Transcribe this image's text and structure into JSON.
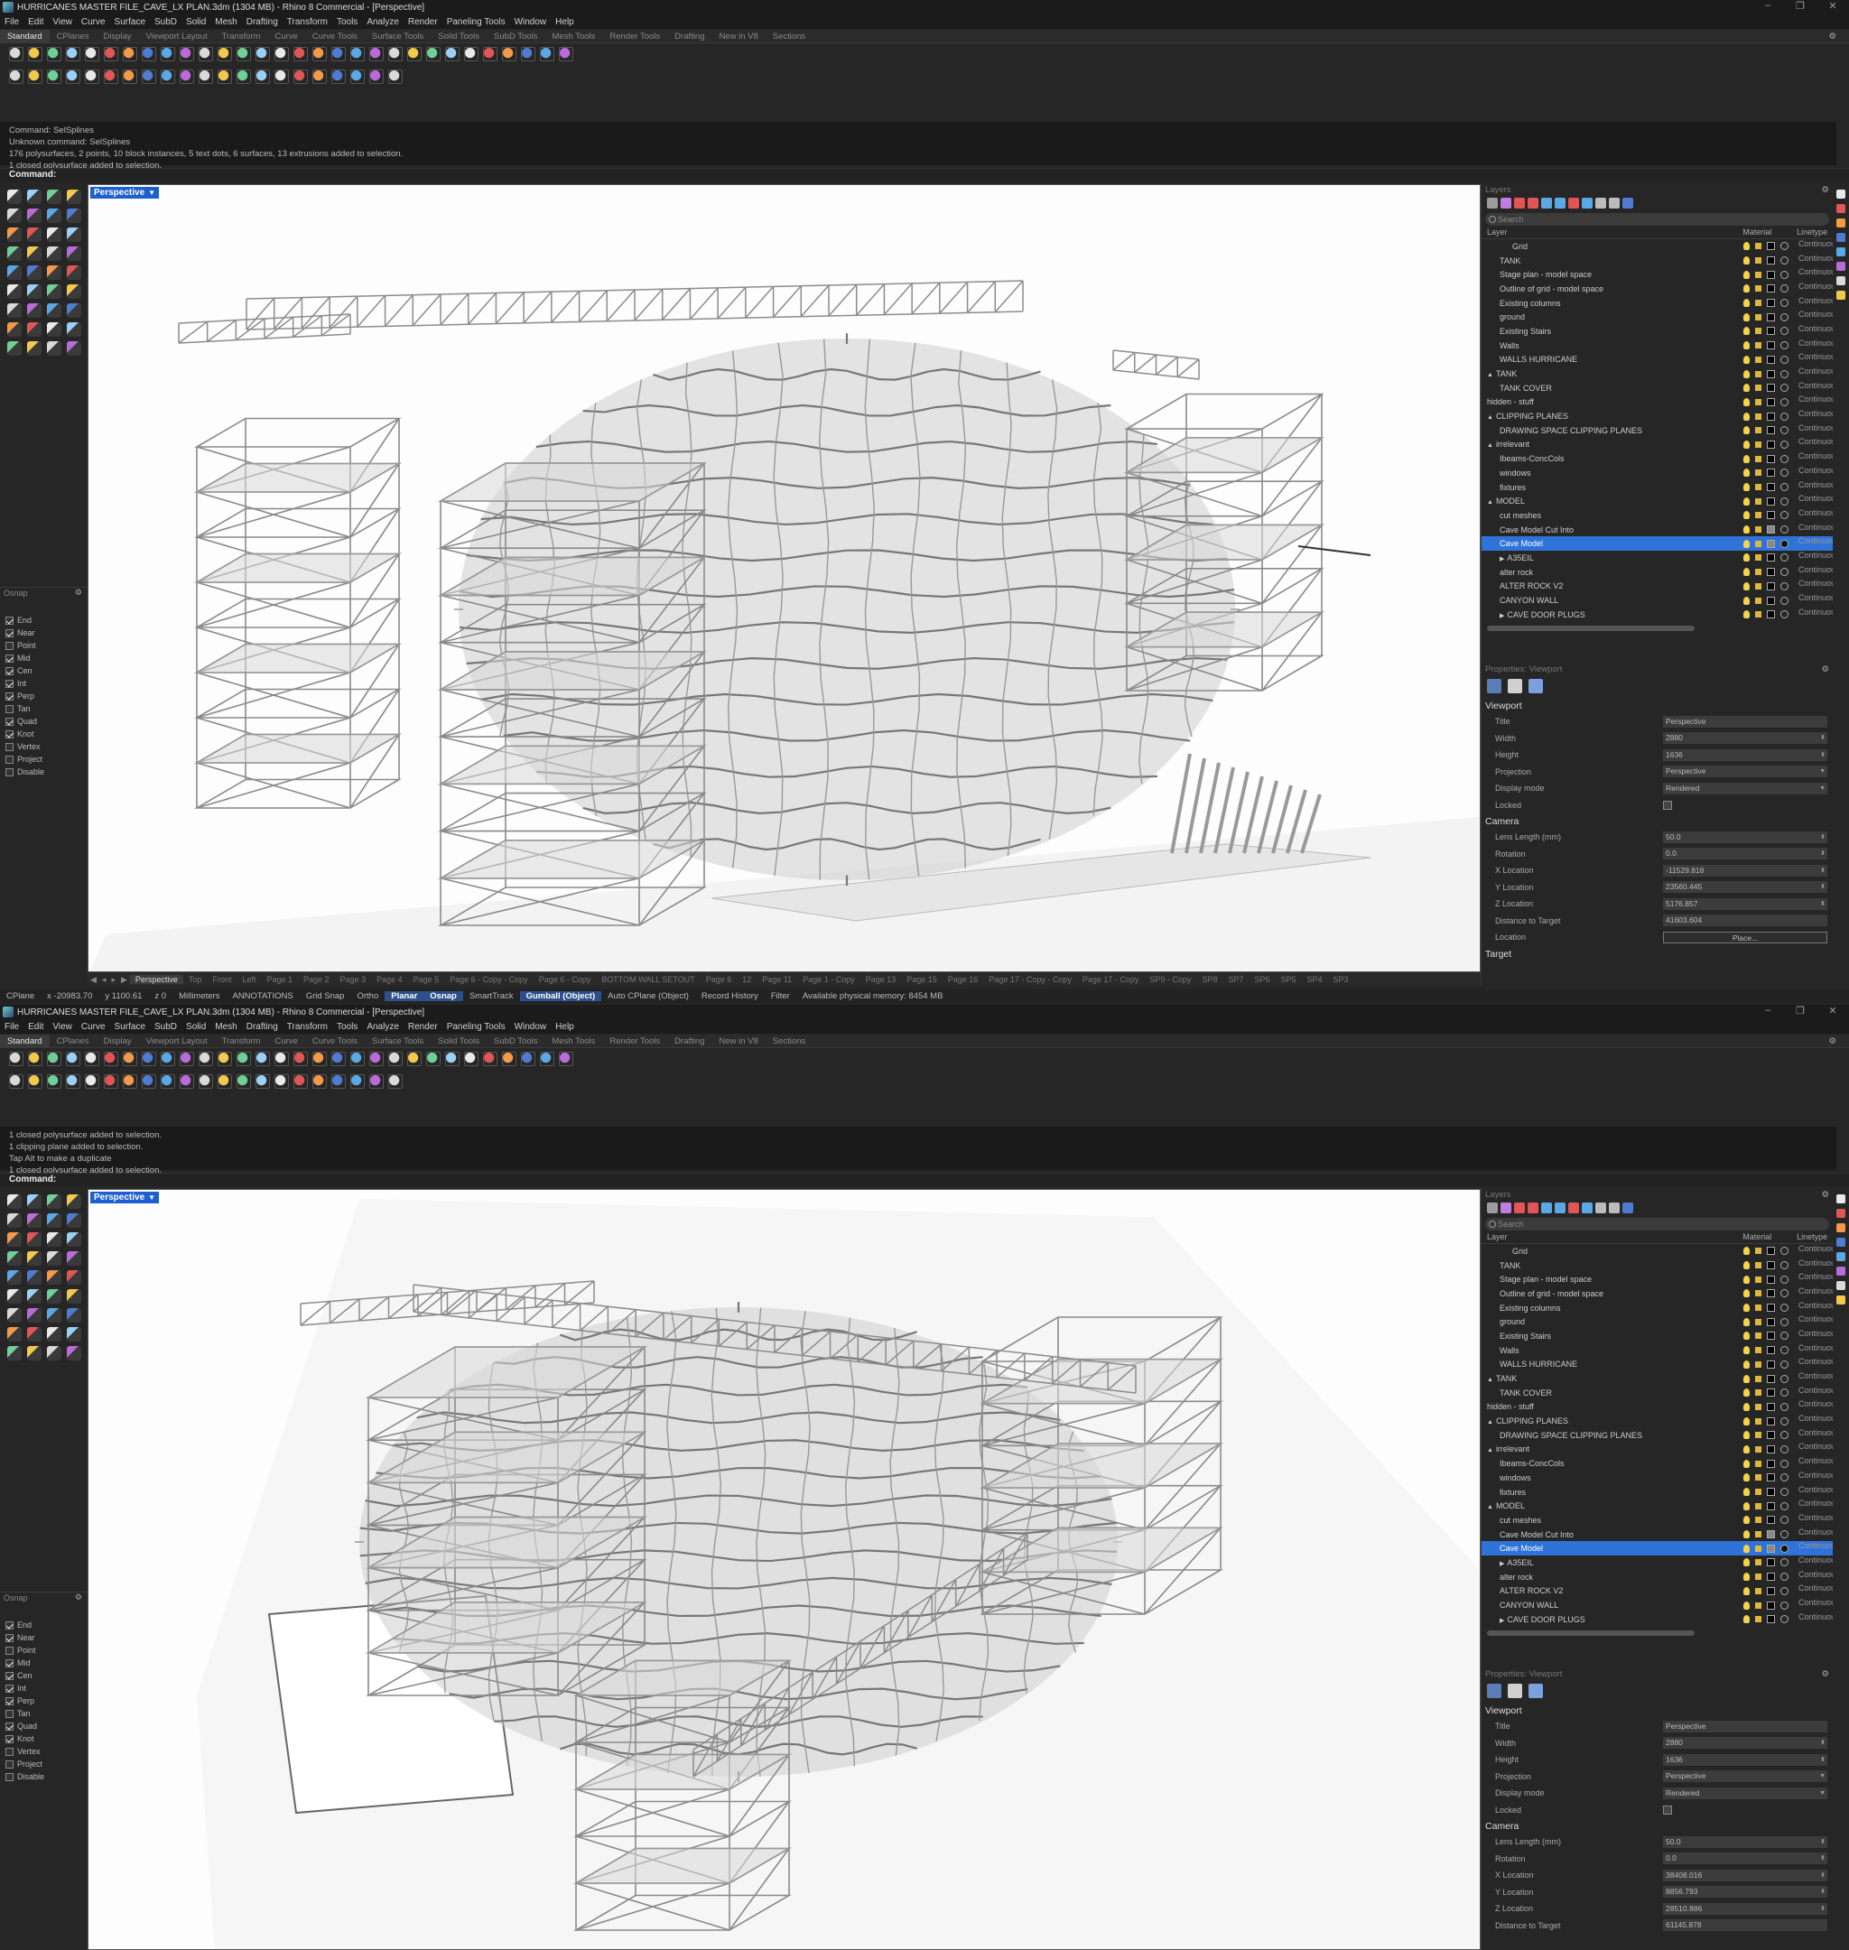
{
  "window": {
    "title": "HURRICANES MASTER FILE_CAVE_LX PLAN.3dm (1304 MB) - Rhino 8 Commercial - [Perspective]",
    "controls": [
      "–",
      "❐",
      "✕"
    ]
  },
  "menu": [
    "File",
    "Edit",
    "View",
    "Curve",
    "Surface",
    "SubD",
    "Solid",
    "Mesh",
    "Drafting",
    "Transform",
    "Tools",
    "Analyze",
    "Render",
    "Paneling Tools",
    "Window",
    "Help"
  ],
  "tabs": [
    "Standard",
    "CPlanes",
    "Display",
    "Viewport Layout",
    "Transform",
    "Curve",
    "Curve Tools",
    "Surface Tools",
    "Solid Tools",
    "SubD Tools",
    "Mesh Tools",
    "Render Tools",
    "Drafting",
    "New in V8",
    "Sections"
  ],
  "icons": {
    "toolbar1": [
      "new",
      "open",
      "save",
      "print",
      "import",
      "cut",
      "copy",
      "paste",
      "undo",
      "pan",
      "rotate",
      "zoom-extents",
      "zoom-window",
      "zoom-selected",
      "zoom-all",
      "viewport-layout",
      "4-views",
      "set-view",
      "display-shaded",
      "rendered",
      "properties",
      "layers",
      "lights",
      "sun",
      "bulb",
      "material",
      "environment",
      "render",
      "named-views",
      "help"
    ],
    "toolbar2": [
      "bulb-on",
      "bulb-all",
      "bulb-sel",
      "bulb-inv",
      "bulb-swap",
      "paper",
      "doc-props",
      "doc-stack",
      "lock",
      "unlock",
      "lock-sel",
      "hide",
      "show-sel",
      "grid",
      "grid-all",
      "render-win",
      "tool-lock",
      "tool-mesh",
      "cloud",
      "world",
      "sphere"
    ],
    "left": [
      "select",
      "point",
      "line",
      "polyline",
      "circle",
      "arc",
      "ellipse",
      "rectangle",
      "curve",
      "curve-cp",
      "fillet",
      "offset",
      "surface",
      "extrude",
      "loft",
      "sweep",
      "solid-box",
      "solid-sphere",
      "boolean",
      "shell",
      "move",
      "copy",
      "rotate",
      "scale",
      "text",
      "dim",
      "hatch",
      "annotate",
      "mesh",
      "grid-array",
      "mirror",
      "trim",
      "check",
      "split",
      "join",
      "sun"
    ]
  },
  "command_label": "Command:",
  "windows": [
    {
      "history": [
        "Command: SelSplines",
        "Unknown command: SelSplines",
        "176 polysurfaces, 2 points, 10 block instances, 5 text dots, 6 surfaces, 13 extrusions added to selection.",
        "1 closed polysurface added to selection."
      ],
      "viewport": {
        "name": "Perspective"
      },
      "pagetabs": [
        "Perspective",
        "Top",
        "Front",
        "Left",
        "Page 1",
        "Page 2",
        "Page 3",
        "Page 4",
        "Page 5",
        "Page 6 - Copy - Copy",
        "Page 6 - Copy",
        "BOTTOM WALL SETOUT",
        "Page 6",
        "12",
        "Page 11",
        "Page 1 - Copy",
        "Page 13",
        "Page 15",
        "Page 16",
        "Page 17 - Copy - Copy",
        "Page 17 - Copy",
        "SP9 - Copy",
        "SP8",
        "SP7",
        "SP6",
        "SP5",
        "SP4",
        "SP3"
      ],
      "status": {
        "cplane": "CPlane",
        "x": "x -20983.70",
        "y": "y 1100.61",
        "z": "z 0",
        "units": "Millimeters",
        "layer": "ANNOTATIONS",
        "grid_snap": "Grid Snap",
        "ortho": "Ortho",
        "planar": "Planar",
        "osnap": "Osnap",
        "smarttrack": "SmartTrack",
        "gumball": "Gumball (Object)",
        "auto_cplane": "Auto CPlane (Object)",
        "record_history": "Record History",
        "filter": "Filter",
        "memory": "Available physical memory: 8454 MB"
      },
      "camera": {
        "lens": "50.0",
        "rotation": "0.0",
        "x": "-11529.818",
        "y": "23560.445",
        "z": "5176.857",
        "distance": "41603.604"
      }
    },
    {
      "history": [
        "1 closed polysurface added to selection.",
        "1 clipping plane added to selection.",
        "Tap Alt to make a duplicate",
        "1 closed polysurface added to selection."
      ],
      "viewport": {
        "name": "Perspective"
      },
      "camera": {
        "lens": "50.0",
        "rotation": "0.0",
        "x": "38408.016",
        "y": "8856.793",
        "z": "28510.886",
        "distance": "61145.878"
      }
    }
  ],
  "osnap": {
    "title": "Osnap",
    "items": [
      {
        "label": "End",
        "on": true
      },
      {
        "label": "Near",
        "on": true
      },
      {
        "label": "Point",
        "on": false
      },
      {
        "label": "Mid",
        "on": true
      },
      {
        "label": "Cen",
        "on": true
      },
      {
        "label": "Int",
        "on": true
      },
      {
        "label": "Perp",
        "on": true
      },
      {
        "label": "Tan",
        "on": false
      },
      {
        "label": "Quad",
        "on": true
      },
      {
        "label": "Knot",
        "on": true
      },
      {
        "label": "Vertex",
        "on": false
      },
      {
        "label": "Project",
        "on": false
      },
      {
        "label": "Disable",
        "on": false
      }
    ]
  },
  "layers": {
    "title": "Layers",
    "search_placeholder": "Search",
    "headers": {
      "layer": "Layer",
      "material": "Material",
      "linetype": "Linetype"
    },
    "linetype_value": "Continuous",
    "rows": [
      {
        "name": "Grid",
        "indent": 2,
        "expand": "",
        "selected": false
      },
      {
        "name": "TANK",
        "indent": 1,
        "expand": "",
        "selected": false
      },
      {
        "name": "Stage plan - model space",
        "indent": 1,
        "expand": "",
        "selected": false
      },
      {
        "name": "Outline of grid - model space",
        "indent": 1,
        "expand": "",
        "selected": false
      },
      {
        "name": "Existing columns",
        "indent": 1,
        "expand": "",
        "selected": false
      },
      {
        "name": "ground",
        "indent": 1,
        "expand": "",
        "selected": false
      },
      {
        "name": "Existing Stairs",
        "indent": 1,
        "expand": "",
        "selected": false
      },
      {
        "name": "Walls",
        "indent": 1,
        "expand": "",
        "selected": false
      },
      {
        "name": "WALLS HURRICANE",
        "indent": 1,
        "expand": "",
        "selected": false
      },
      {
        "name": "TANK",
        "indent": 0,
        "expand": "▲",
        "selected": false
      },
      {
        "name": "TANK COVER",
        "indent": 1,
        "expand": "",
        "selected": false
      },
      {
        "name": "hidden - stuff",
        "indent": 0,
        "expand": "",
        "selected": false
      },
      {
        "name": "CLIPPING PLANES",
        "indent": 0,
        "expand": "▲",
        "selected": false
      },
      {
        "name": "DRAWING SPACE CLIPPING PLANES",
        "indent": 1,
        "expand": "",
        "selected": false
      },
      {
        "name": "irrelevant",
        "indent": 0,
        "expand": "▲",
        "selected": false
      },
      {
        "name": "Ibeams-ConcCols",
        "indent": 1,
        "expand": "",
        "selected": false
      },
      {
        "name": "windows",
        "indent": 1,
        "expand": "",
        "selected": false
      },
      {
        "name": "fixtures",
        "indent": 1,
        "expand": "",
        "selected": false
      },
      {
        "name": "MODEL",
        "indent": 0,
        "expand": "▲",
        "selected": false
      },
      {
        "name": "cut meshes",
        "indent": 1,
        "expand": "",
        "selected": false
      },
      {
        "name": "Cave Model Cut Into",
        "indent": 1,
        "expand": "",
        "selected": false
      },
      {
        "name": "Cave Model",
        "indent": 1,
        "expand": "",
        "selected": true
      },
      {
        "name": "A35EIL",
        "indent": 1,
        "expand": "▶",
        "selected": false
      },
      {
        "name": "alter rock",
        "indent": 1,
        "expand": "",
        "selected": false
      },
      {
        "name": "ALTER ROCK V2",
        "indent": 1,
        "expand": "",
        "selected": false
      },
      {
        "name": "CANYON WALL",
        "indent": 1,
        "expand": "",
        "selected": false
      },
      {
        "name": "CAVE DOOR PLUGS",
        "indent": 1,
        "expand": "▶",
        "selected": false
      }
    ]
  },
  "properties": {
    "title": "Properties: Viewport",
    "viewport_section": "Viewport",
    "camera_section": "Camera",
    "target_section": "Target",
    "labels": {
      "title": "Title",
      "width": "Width",
      "height": "Height",
      "projection": "Projection",
      "display_mode": "Display mode",
      "locked": "Locked",
      "lens": "Lens Length (mm)",
      "rotation": "Rotation",
      "x": "X Location",
      "y": "Y Location",
      "z": "Z Location",
      "distance": "Distance to Target",
      "location": "Location"
    },
    "values": {
      "title": "Perspective",
      "width": "2880",
      "height": "1636",
      "projection": "Perspective",
      "display_mode": "Rendered",
      "place": "Place..."
    }
  },
  "colors": {
    "selection": "#2f73d9",
    "viewport_tab": "#1e5fcf",
    "panel": "#262626",
    "status_highlight": "#2d4f8a"
  }
}
